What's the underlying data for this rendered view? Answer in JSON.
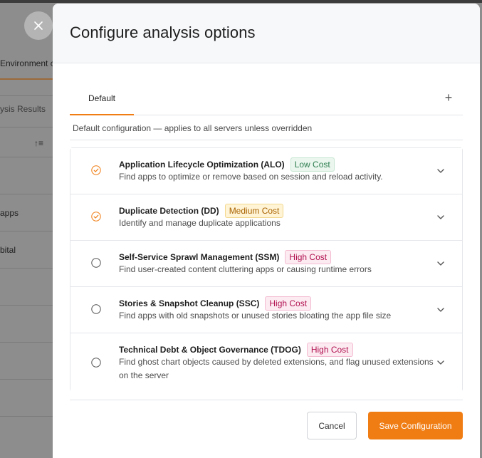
{
  "background": {
    "tab_label": "Environment c",
    "subtab_label": "ysis Results",
    "sort_icon": "sort-icon",
    "rows": [
      "apps",
      "bital"
    ]
  },
  "modal": {
    "title": "Configure analysis options",
    "tabs": [
      {
        "label": "Default",
        "active": true
      }
    ],
    "add_tab_label": "+",
    "description": "Default configuration — applies to all servers unless overridden",
    "options": [
      {
        "title": "Application Lifecycle Optimization (ALO)",
        "badge": "Low Cost",
        "badge_level": "low",
        "selected": true,
        "description": "Find apps to optimize or remove based on session and reload activity."
      },
      {
        "title": "Duplicate Detection (DD)",
        "badge": "Medium Cost",
        "badge_level": "medium",
        "selected": true,
        "description": "Identify and manage duplicate applications"
      },
      {
        "title": "Self-Service Sprawl Management (SSM)",
        "badge": "High Cost",
        "badge_level": "high",
        "selected": false,
        "description": "Find user-created content cluttering apps or causing runtime errors"
      },
      {
        "title": "Stories & Snapshot Cleanup (SSC)",
        "badge": "High Cost",
        "badge_level": "high",
        "selected": false,
        "description": "Find apps with old snapshots or unused stories bloating the app file size"
      },
      {
        "title": "Technical Debt & Object Governance (TDOG)",
        "badge": "High Cost",
        "badge_level": "high",
        "selected": false,
        "description": "Find ghost chart objects caused by deleted extensions, and flag unused extensions on the server"
      }
    ],
    "buttons": {
      "cancel": "Cancel",
      "save": "Save Configuration"
    }
  },
  "colors": {
    "accent": "#f07d14",
    "low": "#2e7d4f",
    "medium": "#a86200",
    "high": "#b0124f"
  }
}
